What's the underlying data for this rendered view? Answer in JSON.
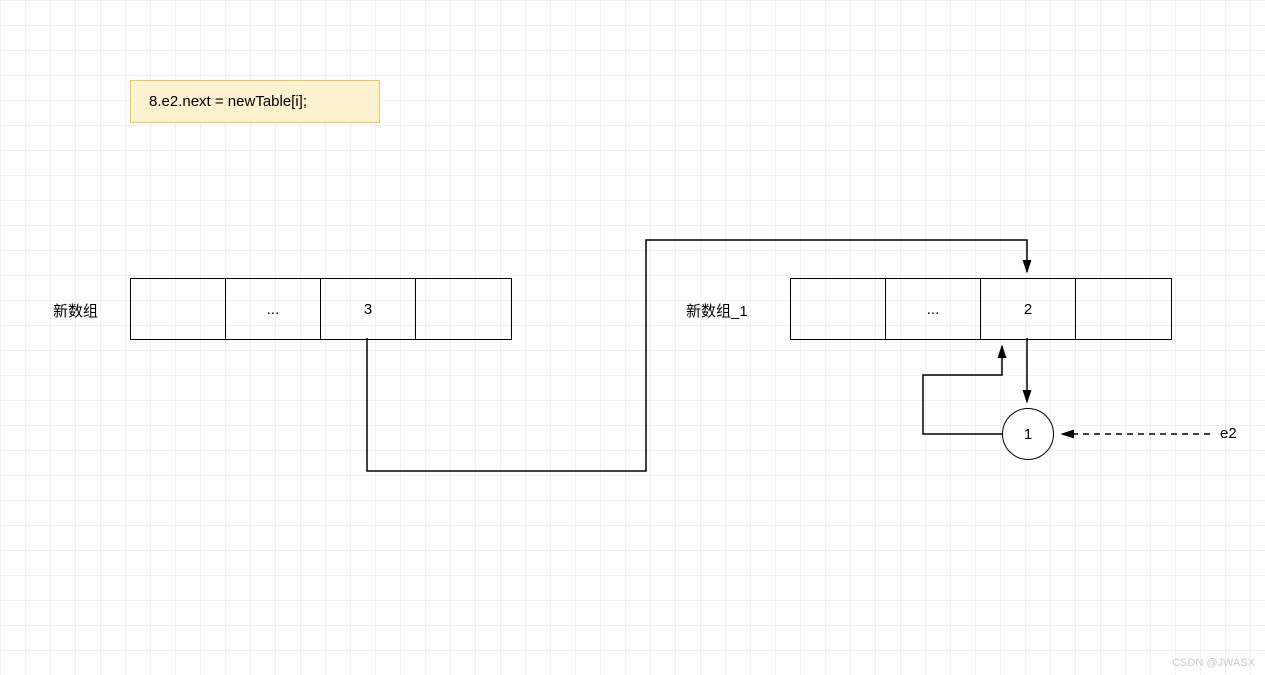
{
  "note": {
    "text": "8.e2.next = newTable[i];"
  },
  "leftArray": {
    "label": "新数组",
    "cells": [
      "",
      "...",
      "3",
      ""
    ]
  },
  "rightArray": {
    "label": "新数组_1",
    "cells": [
      "",
      "...",
      "2",
      ""
    ]
  },
  "node1": {
    "value": "1"
  },
  "pointerLabel": "e2",
  "watermark": "CSDN @JWASX"
}
